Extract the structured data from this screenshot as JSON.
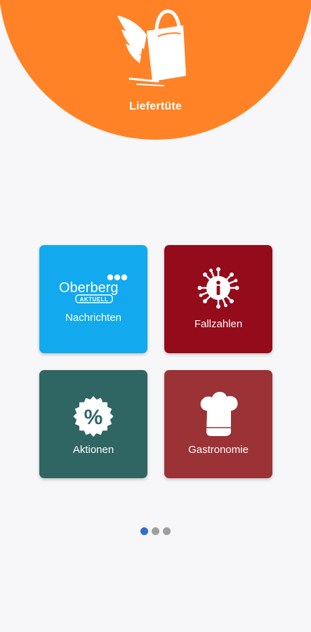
{
  "app": {
    "title": "Liefertüte"
  },
  "colors": {
    "header": "#ff8226",
    "background": "#f7f7f9",
    "dot_active": "#2f6fd0",
    "dot_inactive": "#9e9e9e"
  },
  "tiles": [
    {
      "label": "Nachrichten",
      "brand": "Oberberg",
      "brand_sub": "AKTUELL",
      "icon": "oberberg-aktuell-logo",
      "color": "#12a9ee"
    },
    {
      "label": "Fallzahlen",
      "icon": "virus-info-icon",
      "color": "#940b1b"
    },
    {
      "label": "Aktionen",
      "icon": "percent-badge-icon",
      "color": "#2f6563"
    },
    {
      "label": "Gastronomie",
      "icon": "chef-hat-icon",
      "color": "#9b3235"
    }
  ],
  "pagination": {
    "pages": 3,
    "current": 1
  }
}
